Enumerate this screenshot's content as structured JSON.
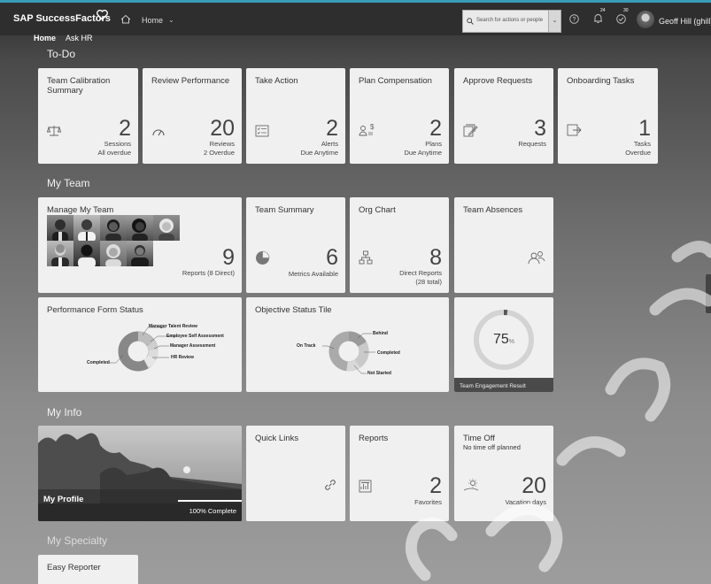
{
  "shell": {
    "logo": "SAP SuccessFactors",
    "home_label": "Home",
    "search_placeholder": "Search for actions or people",
    "notifications_count": "24",
    "approvals_count": "30",
    "user_name": "Geoff Hill (ghill)"
  },
  "subnav": {
    "home": "Home",
    "ask_hr": "Ask HR"
  },
  "sections": {
    "todo": "To-Do",
    "my_team": "My Team",
    "my_info": "My Info",
    "my_specialty": "My Specialty"
  },
  "todo": [
    {
      "title": "Team Calibration Summary",
      "number": "2",
      "line1": "Sessions",
      "line2": "All overdue",
      "icon": "scale-icon"
    },
    {
      "title": "Review Performance",
      "number": "20",
      "line1": "Reviews",
      "line2": "2 Overdue",
      "icon": "gauge-icon"
    },
    {
      "title": "Take Action",
      "number": "2",
      "line1": "Alerts",
      "line2": "Due Anytime",
      "icon": "checklist-icon"
    },
    {
      "title": "Plan Compensation",
      "number": "2",
      "line1": "Plans",
      "line2": "Due Anytime",
      "icon": "compensation-icon"
    },
    {
      "title": "Approve Requests",
      "number": "3",
      "line1": "",
      "line2": "Requests",
      "icon": "approve-icon"
    },
    {
      "title": "Onboarding Tasks",
      "number": "1",
      "line1": "Tasks",
      "line2": "Overdue",
      "icon": "onboarding-icon"
    }
  ],
  "team": {
    "manage": {
      "title": "Manage My Team",
      "number": "9",
      "label": "Reports (8 Direct)"
    },
    "summary": {
      "title": "Team Summary",
      "number": "6",
      "label": "Metrics Available"
    },
    "org": {
      "title": "Org Chart",
      "number": "8",
      "line1": "Direct Reports",
      "line2": "(28 total)"
    },
    "absences": {
      "title": "Team Absences"
    },
    "perf_form": {
      "title": "Performance Form Status",
      "labels": [
        "Manager Talent Review",
        "Employee Self Assessment",
        "Manager Assessment",
        "HR Review",
        "Completed"
      ]
    },
    "objective": {
      "title": "Objective Status Tile",
      "labels": [
        "Behind",
        "On Track",
        "Completed",
        "Not Started"
      ]
    },
    "engagement": {
      "value": "75",
      "unit": "%",
      "label": "Team Engagement Result",
      "fraction": 0.75
    }
  },
  "info": {
    "profile": {
      "name": "My Profile",
      "complete": "100% Complete",
      "fraction": 1.0
    },
    "quick_links": {
      "title": "Quick Links"
    },
    "reports": {
      "title": "Reports",
      "number": "2",
      "label": "Favorites"
    },
    "time_off": {
      "title": "Time Off",
      "subtitle": "No time off planned",
      "number": "20",
      "label": "Vacation days"
    }
  },
  "specialty": {
    "easy_reporter": {
      "title": "Easy Reporter"
    }
  },
  "colors": {
    "accent": "#3a9bb8",
    "tile": "#f0f0f0",
    "shell": "#2e2e2e"
  }
}
